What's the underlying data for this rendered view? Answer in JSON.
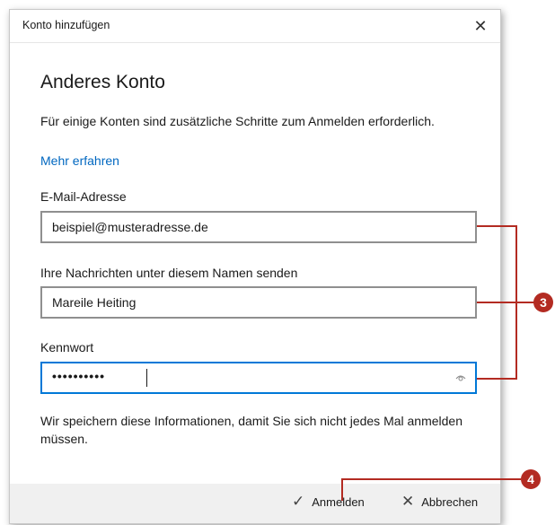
{
  "dialog": {
    "title": "Konto hinzufügen",
    "close_glyph": "✕",
    "heading": "Anderes Konto",
    "description": "Für einige Konten sind zusätzliche Schritte zum Anmelden erforderlich.",
    "learn_more": "Mehr erfahren"
  },
  "form": {
    "email_label": "E-Mail-Adresse",
    "email_value": "beispiel@musteradresse.de",
    "name_label": "Ihre Nachrichten unter diesem Namen senden",
    "name_value": "Mareile Heiting",
    "password_label": "Kennwort",
    "password_value": "••••••••••"
  },
  "note": "Wir speichern diese Informationen, damit Sie sich nicht jedes Mal anmelden müssen.",
  "footer": {
    "signin_label": "Anmelden",
    "signin_icon": "checkmark-icon",
    "cancel_label": "Abbrechen",
    "cancel_icon": "close-icon"
  },
  "annotations": {
    "badge_3": "3",
    "badge_4": "4",
    "color": "#b32b22"
  },
  "colors": {
    "accent": "#0078d7",
    "link": "#0067c0",
    "footer_bg": "#f0f0f0"
  }
}
